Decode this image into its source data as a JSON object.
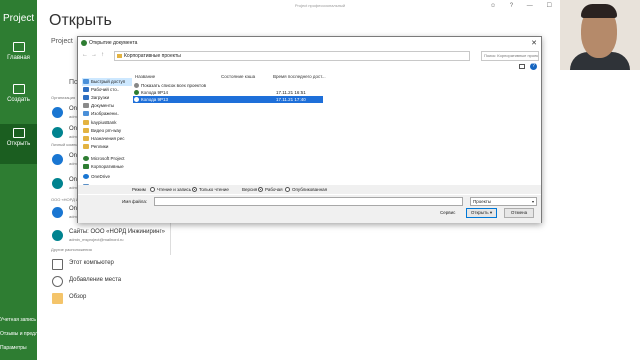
{
  "window": {
    "title_header": "Project профессиональный"
  },
  "rail": {
    "app_name": "Project",
    "items": [
      {
        "label": "Главная",
        "icon": "home-icon"
      },
      {
        "label": "Создать",
        "icon": "new-document-icon"
      },
      {
        "label": "Открыть",
        "icon": "open-folder-icon",
        "active": true
      }
    ],
    "footer": [
      {
        "label": "Учетная запись"
      },
      {
        "label": "Отзывы и предложения"
      },
      {
        "label": "Параметры"
      }
    ]
  },
  "backstage": {
    "title": "Открыть",
    "project_label": "Project",
    "recent_label": "По",
    "sections": [
      "Организация",
      "Личный компьютер",
      "ООО «НОРД ИНЖИНИРИНГ»",
      "Другие расположения"
    ],
    "locations": [
      {
        "label": "On",
        "sub": "adm",
        "icon": "onedrive-icon"
      },
      {
        "label": "On",
        "sub": "adm",
        "icon": "onedrive-icon"
      },
      {
        "label": "On",
        "sub": "adm",
        "icon": "onedrive-icon"
      },
      {
        "label": "On",
        "sub": "adm",
        "icon": "sharepoint-icon"
      },
      {
        "label": "On",
        "sub": "adm",
        "icon": "onedrive-icon"
      },
      {
        "label": "On",
        "sub": "adm",
        "icon": "sharepoint-icon"
      },
      {
        "label": "Сайты: ООО «НОРД Инжиниринг»",
        "sub": "admin_msproject@mailnord.ru",
        "icon": "sharepoint-icon"
      },
      {
        "label": "Этот компьютер",
        "sub": "",
        "icon": "computer-icon"
      },
      {
        "label": "Добавление места",
        "sub": "",
        "icon": "globe-icon"
      },
      {
        "label": "Обзор",
        "sub": "",
        "icon": "folder-icon"
      }
    ]
  },
  "dialog": {
    "title": "Открытие документа",
    "address": "Корпоративные проекты",
    "search_placeholder": "Поиск: Корпоративные проек...",
    "nav_items": [
      {
        "label": "Быстрый доступ",
        "selected": true,
        "color": "#4a90d9"
      },
      {
        "label": "Рабочий сто..",
        "color": "#2e6fc2"
      },
      {
        "label": "Загрузки",
        "color": "#2e6fc2"
      },
      {
        "label": "Документы",
        "color": "#8a8a8a"
      },
      {
        "label": "Изображени..",
        "color": "#4a90d9"
      },
      {
        "label": "kaypiusBank",
        "color": "#e3b341"
      },
      {
        "label": "Видео pm-way",
        "color": "#e3b341"
      },
      {
        "label": "Назначения рес",
        "color": "#e3b341"
      },
      {
        "label": "Реплики",
        "color": "#e3b341"
      },
      {
        "label": "Microsoft Project",
        "color": "#2e7d32"
      },
      {
        "label": "Корпоративные",
        "color": "#2e7d32"
      },
      {
        "label": "OneDrive",
        "color": "#1976d2"
      },
      {
        "label": "Этот компьютер",
        "color": "#5a8fc6"
      }
    ],
    "columns": [
      "Название",
      "Состояние кэша",
      "Время последнего дост..."
    ],
    "rows": [
      {
        "name": "Показать список всех проектов",
        "cache": "",
        "time": ""
      },
      {
        "name": "Колода 9Р14",
        "cache": "",
        "time": "17.11.21 16:51"
      },
      {
        "name": "Колода 9Р13",
        "cache": "",
        "time": "17.11.21 17:40",
        "selected": true
      }
    ],
    "mode": {
      "label": "Режим",
      "options": [
        {
          "label": "Чтение и запись",
          "on": false
        },
        {
          "label": "Только чтение",
          "on": true
        }
      ],
      "version_label": "Версия",
      "versions": [
        {
          "label": "Рабочая",
          "on": true
        },
        {
          "label": "Опубликованная",
          "on": false
        }
      ]
    },
    "filename_label": "Имя файла:",
    "filename_value": "",
    "filetype": "Проекты",
    "service_label": "Сервис",
    "open_button": "Открыть",
    "cancel_button": "Отмена"
  }
}
